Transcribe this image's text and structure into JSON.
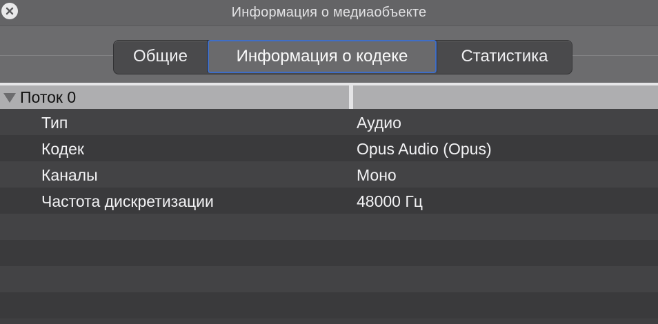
{
  "window": {
    "title": "Информация о медиаобъекте"
  },
  "tabs": [
    {
      "label": "Общие",
      "selected": false
    },
    {
      "label": "Информация о кодеке",
      "selected": true
    },
    {
      "label": "Статистика",
      "selected": false
    }
  ],
  "stream": {
    "header": "Поток 0",
    "expanded": true,
    "rows": [
      {
        "key": "Тип",
        "value": "Аудио"
      },
      {
        "key": "Кодек",
        "value": "Opus Audio (Opus)"
      },
      {
        "key": "Каналы",
        "value": "Моно"
      },
      {
        "key": "Частота дискретизации",
        "value": "48000 Гц"
      },
      {
        "key": "",
        "value": ""
      },
      {
        "key": "",
        "value": ""
      },
      {
        "key": "",
        "value": ""
      },
      {
        "key": "",
        "value": ""
      }
    ]
  },
  "icons": {
    "close": "close-icon",
    "disclosure": "disclosure-triangle-icon"
  },
  "colors": {
    "accent": "#3f6ec7",
    "header_background": "#aeaeb0",
    "window_background": "#3f3f41"
  }
}
